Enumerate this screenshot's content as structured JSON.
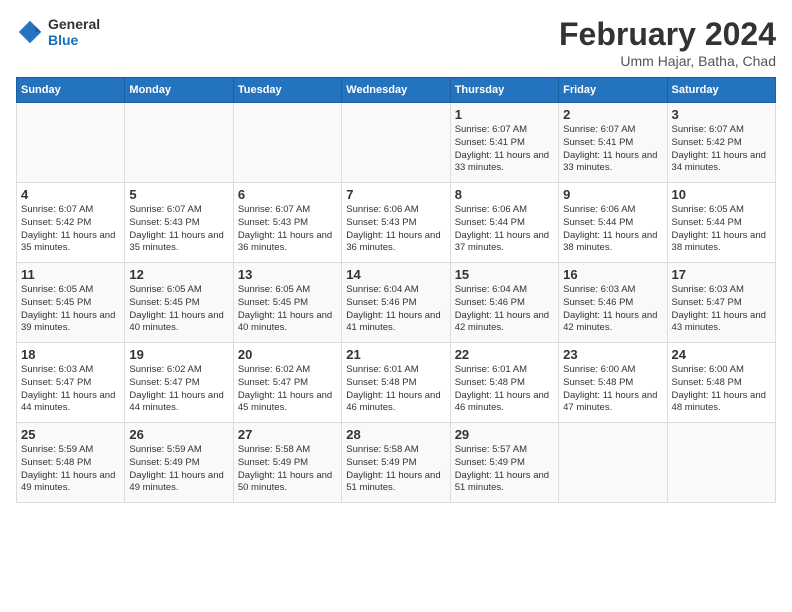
{
  "header": {
    "logo_general": "General",
    "logo_blue": "Blue",
    "month_title": "February 2024",
    "location": "Umm Hajar, Batha, Chad"
  },
  "days_of_week": [
    "Sunday",
    "Monday",
    "Tuesday",
    "Wednesday",
    "Thursday",
    "Friday",
    "Saturday"
  ],
  "weeks": [
    [
      {
        "day": "",
        "info": ""
      },
      {
        "day": "",
        "info": ""
      },
      {
        "day": "",
        "info": ""
      },
      {
        "day": "",
        "info": ""
      },
      {
        "day": "1",
        "info": "Sunrise: 6:07 AM\nSunset: 5:41 PM\nDaylight: 11 hours and 33 minutes."
      },
      {
        "day": "2",
        "info": "Sunrise: 6:07 AM\nSunset: 5:41 PM\nDaylight: 11 hours and 33 minutes."
      },
      {
        "day": "3",
        "info": "Sunrise: 6:07 AM\nSunset: 5:42 PM\nDaylight: 11 hours and 34 minutes."
      }
    ],
    [
      {
        "day": "4",
        "info": "Sunrise: 6:07 AM\nSunset: 5:42 PM\nDaylight: 11 hours and 35 minutes."
      },
      {
        "day": "5",
        "info": "Sunrise: 6:07 AM\nSunset: 5:43 PM\nDaylight: 11 hours and 35 minutes."
      },
      {
        "day": "6",
        "info": "Sunrise: 6:07 AM\nSunset: 5:43 PM\nDaylight: 11 hours and 36 minutes."
      },
      {
        "day": "7",
        "info": "Sunrise: 6:06 AM\nSunset: 5:43 PM\nDaylight: 11 hours and 36 minutes."
      },
      {
        "day": "8",
        "info": "Sunrise: 6:06 AM\nSunset: 5:44 PM\nDaylight: 11 hours and 37 minutes."
      },
      {
        "day": "9",
        "info": "Sunrise: 6:06 AM\nSunset: 5:44 PM\nDaylight: 11 hours and 38 minutes."
      },
      {
        "day": "10",
        "info": "Sunrise: 6:05 AM\nSunset: 5:44 PM\nDaylight: 11 hours and 38 minutes."
      }
    ],
    [
      {
        "day": "11",
        "info": "Sunrise: 6:05 AM\nSunset: 5:45 PM\nDaylight: 11 hours and 39 minutes."
      },
      {
        "day": "12",
        "info": "Sunrise: 6:05 AM\nSunset: 5:45 PM\nDaylight: 11 hours and 40 minutes."
      },
      {
        "day": "13",
        "info": "Sunrise: 6:05 AM\nSunset: 5:45 PM\nDaylight: 11 hours and 40 minutes."
      },
      {
        "day": "14",
        "info": "Sunrise: 6:04 AM\nSunset: 5:46 PM\nDaylight: 11 hours and 41 minutes."
      },
      {
        "day": "15",
        "info": "Sunrise: 6:04 AM\nSunset: 5:46 PM\nDaylight: 11 hours and 42 minutes."
      },
      {
        "day": "16",
        "info": "Sunrise: 6:03 AM\nSunset: 5:46 PM\nDaylight: 11 hours and 42 minutes."
      },
      {
        "day": "17",
        "info": "Sunrise: 6:03 AM\nSunset: 5:47 PM\nDaylight: 11 hours and 43 minutes."
      }
    ],
    [
      {
        "day": "18",
        "info": "Sunrise: 6:03 AM\nSunset: 5:47 PM\nDaylight: 11 hours and 44 minutes."
      },
      {
        "day": "19",
        "info": "Sunrise: 6:02 AM\nSunset: 5:47 PM\nDaylight: 11 hours and 44 minutes."
      },
      {
        "day": "20",
        "info": "Sunrise: 6:02 AM\nSunset: 5:47 PM\nDaylight: 11 hours and 45 minutes."
      },
      {
        "day": "21",
        "info": "Sunrise: 6:01 AM\nSunset: 5:48 PM\nDaylight: 11 hours and 46 minutes."
      },
      {
        "day": "22",
        "info": "Sunrise: 6:01 AM\nSunset: 5:48 PM\nDaylight: 11 hours and 46 minutes."
      },
      {
        "day": "23",
        "info": "Sunrise: 6:00 AM\nSunset: 5:48 PM\nDaylight: 11 hours and 47 minutes."
      },
      {
        "day": "24",
        "info": "Sunrise: 6:00 AM\nSunset: 5:48 PM\nDaylight: 11 hours and 48 minutes."
      }
    ],
    [
      {
        "day": "25",
        "info": "Sunrise: 5:59 AM\nSunset: 5:48 PM\nDaylight: 11 hours and 49 minutes."
      },
      {
        "day": "26",
        "info": "Sunrise: 5:59 AM\nSunset: 5:49 PM\nDaylight: 11 hours and 49 minutes."
      },
      {
        "day": "27",
        "info": "Sunrise: 5:58 AM\nSunset: 5:49 PM\nDaylight: 11 hours and 50 minutes."
      },
      {
        "day": "28",
        "info": "Sunrise: 5:58 AM\nSunset: 5:49 PM\nDaylight: 11 hours and 51 minutes."
      },
      {
        "day": "29",
        "info": "Sunrise: 5:57 AM\nSunset: 5:49 PM\nDaylight: 11 hours and 51 minutes."
      },
      {
        "day": "",
        "info": ""
      },
      {
        "day": "",
        "info": ""
      }
    ]
  ]
}
